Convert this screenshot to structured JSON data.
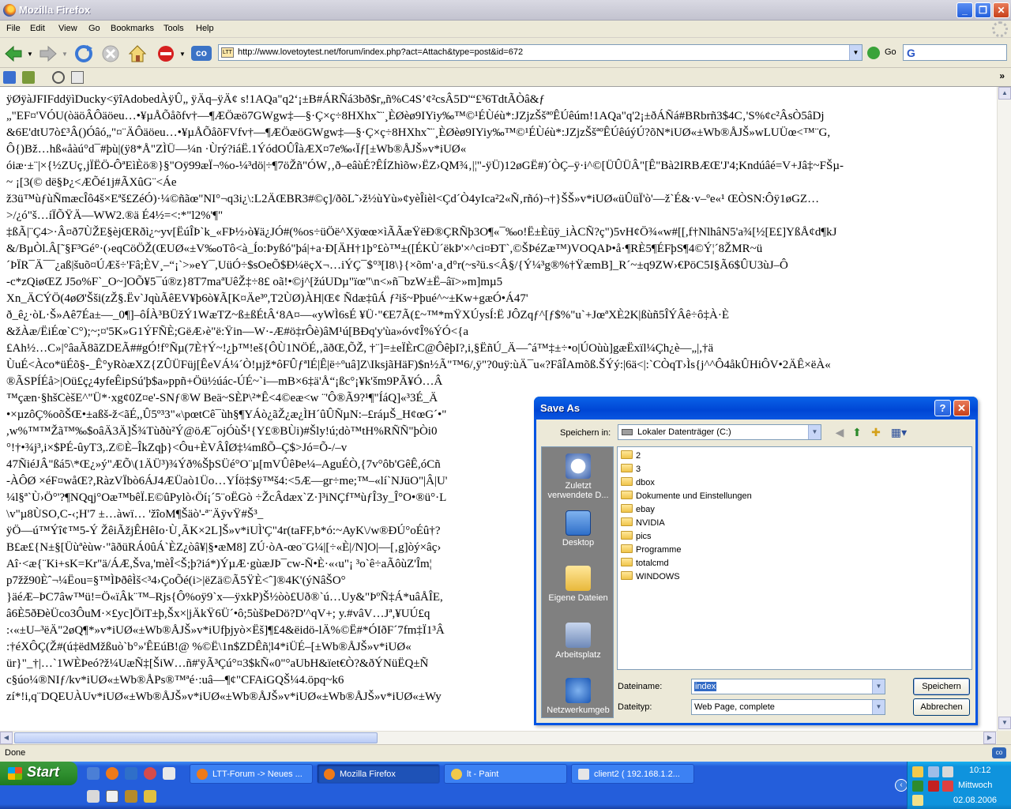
{
  "window": {
    "title": "Mozilla Firefox"
  },
  "menu": {
    "file": "File",
    "edit": "Edit",
    "view": "View",
    "go": "Go",
    "bookmarks": "Bookmarks",
    "tools": "Tools",
    "help": "Help"
  },
  "nav": {
    "url": "http://www.lovetoytest.net/forum/index.php?act=Attach&type=post&id=672",
    "go_label": "Go",
    "url_icon_text": "LTT"
  },
  "content_lines": [
    "ÿØÿàJFIFddÿìDucky<ÿîAdobedÀÿÛ„        ÿÄq–ÿÄ¢   s!1AQa\"q2‘¡±B#ÁRÑá3bð$r„ñ%C4S’¢²csÂ5D'“£³6TdtÃÒâ&ƒ",
    "„\"EF¤'VÓU(òäöÂÔäöeu…•¥µÅÕåõfv†—¶ÆÖæö7GWgw‡—§·Ç×ç÷8HXhx˜¨¸ÈØèø9IYiy‰™©¹ÉÙéù*:JZjzŠšªºÊÚêúm!1AQa\"q'2¡±ðÁÑá#BRbrñ3$4C‚'S%¢c²ÂsÒ5âDj",
    "&6E'dtU7ò£³Â()Óâó„\"¤¨ÄÔäöeu…•¥µÅÕåõFVfv†—¶ÆÖæöGWgw‡—§·Ç×ç÷8HXhx˜¨¸ÈØèø9IYiy‰™©¹ÉÙéù*:JZjzŠšªºÊÚêúýÚ?õN*iUØ«±Wb®ÅJŠ»wLUÜœ<™¨G,",
    "Ô{)Bž…hß«åàú°d¯#þù|(ÿ8*Å\"ZÌÜ—¼n ·Ùrý?iáË.1ÝódOÛÎàÆX¤7e‰‹Ïƒ[±Wb®ÅJŠ»v*iUØ«",
    "óiæ·±¨|×{½ZUç‚jÏËÖ-ÔªEìÈö®}§\"Oÿ99æÏ¬%o-¼³dö|÷¶7öŽñ\"ÓW‚‚ð–eâùÉ?ÊÍZhìõw›ËZ›QM¾‚|¦\"-ÿÜ)12øGË#)´ÒÇ–ÿ·i^©[ÜÛÜÂ\"[Ê\"Bà2IRBÆŒ'J'4;Kndúâé=V+Jâ‡~FŠµ-",
    "~ ¡[3(© dë§Þ¿<ÆÕé1j#ÃXûG¨<Áe",
    "ž3ü™ùƒùÑmæcÎô4š×Eªš£ZéÓ)·¼©ñãœ\"NI°¬q3i¿\\:L2ÄŒBR3#©ç]/ðõL˜›ž½ùYù»¢yèÎièl<Çd´Ò4yIca²2«Ñ‚rñó)¬†}ŠŠ»v*iUØ«üÛüÏ'ò'—ž`É&·v–ºe«¹ ŒÒSN:Ôÿ1øGZ…",
    ">/¿ó\"š…íÏÕŸÄ—WW2.®ä É4½=<:*\"l2%'¶\"",
    "‡ßÃ|¨Ç4>·Â¤ð7ÙŽE§èjŒRðì¿~yv[ËúÎÞ`k_«FÞ½›ò¥ä¿JÓ#(%os÷üÖë^Xÿœœ×ìÃÃæŸëÐ®ÇRÑþ3O¶«¯‰o!Ë±Èüÿ_iÀCÑ?ç\")5vH¢Ö¾«w#[[,f†NlhâN5'a¾[½[E£]YßÅ¢d¶kJ",
    "&/BµÒl.Â[˜§F³Gé°·(›eqCöÖŽ(ŒUØ«±V‰oTô<à_Ío:Þyßó\"þá|+a·Ð[ÄH†1þ°£ò™±([ÉKÙ´ëkÞ'×^ci¤ÐT`,©ŠÞéZæ™)VOQAÞ•å·¶RÈ5¶ÉFþS¶4©Ý¦´8ŽMR~ü",
    "´ÞÏR¯Ä¯¯¿aß|šuõ¤ÚÆš÷'Fâ;ÈV¸–“¡`>»eY¯,UüÓ÷$sOeÕ$Ð¼ëçX¬…iÝÇ¯$°³[I8\\}{×õm'·a¸d°r(~s²ü.s<Â§/{Ý¼³g®%†ŸæmB]_R´~±q9ZW›€PöC5I§Ã6$ÛU3ùJ–Ô",
    "-c*zQiøŒZ J5o%F`_O~]OÕ¥5¯ú®z}8T7maªUêŽ‡÷8£ oã!•©j^[žúUDµ\"ïœ\"\\n<»ñ¯bzW±Ë–âï>»m]mµ5",
    "Xn_ÄCÝÖ(4øØ'Šši(zŽ§.Ëv`JqùÃêEV¥þ6ò¥Ã[K¤Äe³º,T2ÙØ)ÀH|Œ¢ Ñdæ‡ûÁ ƒ²iš~Pþué^~±Kw+gæÓ•Á47'",
    "ð_ê¿·òL·Š»Aê7Éa±—_0¶]–ôÍÀ³BÜžÝ1WæTZ~ß±ßÉtÂ‘8A¤—«yWÌ6sÉ ¥Ü·\"€E7Ã(£~™*mŸXÚysÍ:Ë JÔZqƒ^[ƒ$%\"u`+JœªXÈ2K|ßùñ5ÎÝÂê÷ô‡À·È",
    "&žÀæ/ËiÉœ`C°);~;¤'5K»G1ÝFÑÈ;GëÆ›è\"ë:Ÿin—W·-Æ#ö‡rÔè)âM¹ú[BÐq'y'ùa»óv¢Î%ÝÓ<{a",
    "£Ah½…C»|°âaÃ8ãZDEÃ##gÓ!f°Ñµ(7È†Ý~!¿þ™!eš{ÔÙ1NÖÉ,‚ãðŒ,ÕŽ, †¨]=±eÏÈrC@ÔêþI?,i,§ËñÚ_Ä—ˆá™‡±÷•o|ÚOùù]gæËxïl¼Çh¿è—„|,†ä",
    "ÙuÉ<Àco*üÉõ§-_Ê°yRòæXZ{ZÛÜFüj[ÊeVÁ¼´Ò!µjž*ôFÛƒªlÉ|Ê|ë÷ºuâ]Z\\IksjãHäF)$n½Ã\"™6/,ÿ\"?0uÿ:ùÄ¯u«?FâÎAmõß.ŠÝý:|6ä<|:`CÒqT›Ìs{j^^Ô4åkÛHiÔV•2ÄÊ×ëÀ«",
    "®ÃSPÍÉå>|Oü£ç¿4yfeÊipSú'þ$a»ppñ+Öü½úác-ÚÉ~`i—mB×6‡ä'Å“¡ßc°¡¥k'šm9PÃ¥Ó…Â",
    "™çæn·§hšCèšE^\"Ü*·xg¢0Z¤e'-SNƒ®W Beä~SÈP\\²*Ê<4©eæ<w ¨'Ô®Ã9?¹¶\"ÍáQ]«³3É_Ä",
    "•×µzôÇ%oõŠŒ•±aßš-ž<ãÉ,,Û5º³3\"«\\pœtCê¯ùh§¶YÁò¿ãŽ¿æ¿ÌH´ûÛÑµN:–£ráµŠ_H¢œG´•\"",
    ",w%™™Žã™‰$oâÄ3Ä]Š¾Tùðù²Ý@öÆ¯ojÓùŠ¹{Y£®BÙi)#Šly!ú;dò™tH%RÑÑ\"þÒi0",
    "°!†•¾j³,i×$PÉ-ûyT3,.Z©È–ÎkZqþ}<Ôu+ÈVÂÎØ‡¼mßÕ–Ç$>Jó=Õ-/–v",
    "47ÑiéJÂ\"ßá5\\*Œ¿»ý\"ÆÕ\\(1ÄÜ³)¾Ýð%ŠþSÜé°O¨µ[mVÛêÞe¼–AguÉÒ,{7v°ôb'GêÊ,óCñ",
    "-ÀÔØ ×éF¤wåŒ?,RàzVÏbò6ÁJ4ÆÜaò1Üo…YÍö‡$ÿ™š4:<5Æ—gr÷me;™–«lí`NJüO\"|Â|U'",
    "¼l§ª`Ù›Ö°'?¶NQqj°Oæ™bêÏ.E©ûPylò‹Öí¡´5¨oËGò ÷ŽcÂdæx`Z·]³iNÇf™ùƒÎ3y_Î°O•®ü°·L",
    "\\v\"µ8ÙSO,C-‹;H'7 ±…àwï…  'žîoM¶Šäò'-ª¨ÄÿvŸ#Š³_",
    "ÿÖ—ú™Ýî¢™5-Ý ŽêiÃžjÊHêIo·Ù¸ÃK×2L]Š»v*iUÌ'Ç\"4r(taFF,b*ó:~AyK\\/w®ÐÚ°oÉû†?",
    "B£æ£{N±§[Üùªèùw·\"ãðüRÁ0ûÁ`ÈZ¿òâ¥|§•æM8] ZÚ·òA-œo¨G¼|[÷«È|/N]O|—[‚g]òý×âç›",
    "Aî·<æ{¨Ki+sK=Kr\"ä/ÁÆ,Šva,'mèÎ<Š;þ?iá*)ÝµÆ·gùæJÞ¯cw-Ñ•È·«‹u\"¡ ³o`ê÷aÃôùZ'Îm¦",
    "p7žž90Èˆ¬¼Ëou=§™ÌÞðêÌš<³4›ÇoÕé(i>|ëZä©Ã5ŸÈ<ˆ]®4K'(ýNâŠO°",
    "}äéÆ–ÞC7âw™ü!=Ö«ïÂk¨™–Rjs{Ô%oÿ9`x—ÿxkP)Š½òò£Uð®`ú…Uy&\"ÞºÑ‡Á*uâÅÎE,",
    "â6È5ðÐèÜco3ÔuM·×£yc]ÖiT±þ,Šx×|jÄkŸ6Ü´•ô;5ùšÞeDö?D'^qV+; y.#vâV…Jª,¥UÚ£q",
    ":‹«±U–³ëÄ\"2øQ¶*»v*iUØ«±Wb®ÅJŠ»v*iUfþjyò×Ëš]¶£4&ëidö-lÄ%©Ë#*ÓIðF´7fm‡Ï1³Â",
    ":†éXÔÇ(Ž#(ú‡ëdMžßuò`b°»'ÊEúB!@ %©Ë\\1n$ZDÊñ¦l4*iÜÉ–[±Wb®ÅJŠ»v*iUØ«",
    "ür}\"_†|…`1WÈÞeó?ž¼UæÑ‡[ŠiW…ñ#'ÿÃ³Çú°¤3$kÑ«0\"°aUbH&ïet€Ò?&ðÝNüËQ±Ñ",
    "c§úo¼®NIƒ/kv*iUØ«±Wb®ÅPs®™ªé·:uâ—¶¢\"CFAiGQŠ¼4.öpq~k6",
    "zí*!i,q¨DQEUÀUv*iUØ«±Wb®ÅJŠ»v*iUØ«±Wb®ÅJŠ»v*iUØ«±Wb®ÅJŠ»v*iUØ«±Wy"
  ],
  "status": {
    "text": "Done"
  },
  "dialog": {
    "title": "Save As",
    "save_in_label": "Speichern in:",
    "save_in_value": "Lokaler Datenträger (C:)",
    "places": [
      "Zuletzt verwendete D...",
      "Desktop",
      "Eigene Dateien",
      "Arbeitsplatz",
      "Netzwerkumgeb"
    ],
    "files": [
      "2",
      "3",
      "dbox",
      "Dokumente und Einstellungen",
      "ebay",
      "NVIDIA",
      "pics",
      "Programme",
      "totalcmd",
      "WINDOWS"
    ],
    "filename_label": "Dateiname:",
    "filename_value": "index",
    "filetype_label": "Dateityp:",
    "filetype_value": "Web Page, complete",
    "save_button": "Speichern",
    "cancel_button": "Abbrechen",
    "help_glyph": "?",
    "close_glyph": "✕"
  },
  "taskbar": {
    "start": "Start",
    "tasks": [
      "LTT-Forum -> Neues ...",
      "Mozilla Firefox",
      "lt - Paint",
      "client2 ( 192.168.1.2..."
    ],
    "clock_time": "10:12",
    "clock_day": "Mittwoch",
    "clock_date": "02.08.2006"
  }
}
